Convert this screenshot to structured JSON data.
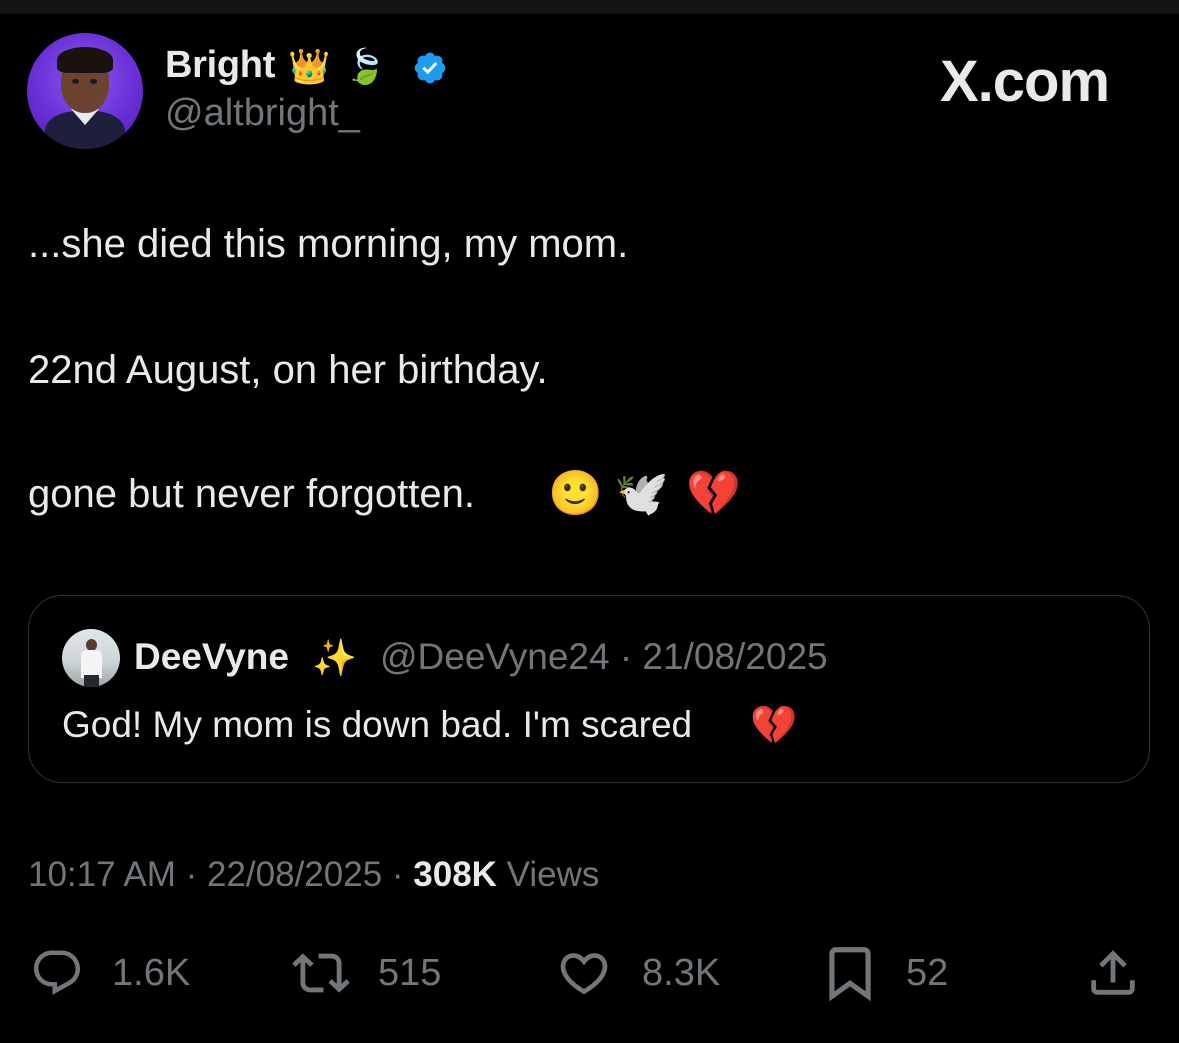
{
  "author": {
    "display_name": "Bright",
    "name_emojis": [
      "👑",
      "🍃"
    ],
    "handle": "@altbright_",
    "verified_icon": "verified-badge-icon",
    "verified_color": "#1d9bf0"
  },
  "brand": "X.com",
  "tweet": {
    "lines": [
      "...she died this morning, my mom.",
      "22nd August, on her birthday.",
      "gone but never forgotten."
    ],
    "end_emojis": [
      "🙂",
      "🕊️",
      "💔"
    ]
  },
  "quoted_tweet": {
    "display_name": "DeeVyne",
    "name_emoji": "✨",
    "handle_and_date": "@DeeVyne24 · 21/08/2025",
    "text": "God! My mom is down bad. I'm scared",
    "text_emoji": "💔"
  },
  "meta": {
    "time_date": "10:17 AM · 22/08/2025 · ",
    "views_count": "308K",
    "views_label": " Views"
  },
  "actions": {
    "replies": "1.6K",
    "reposts": "515",
    "likes": "8.3K",
    "bookmarks": "52"
  },
  "colors": {
    "background": "#000000",
    "primary_text": "#e7e9ea",
    "secondary_text": "#71767b",
    "border": "#2f3336"
  }
}
